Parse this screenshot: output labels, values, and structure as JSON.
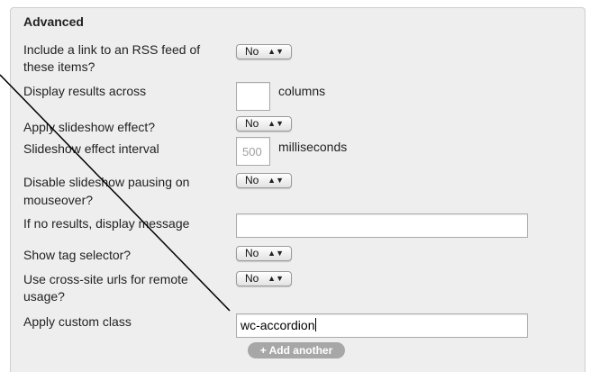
{
  "section": {
    "title": "Advanced"
  },
  "fields": {
    "rss_link": {
      "label_line1": "Include a link to an RSS feed of",
      "label_line2": "these items?",
      "value": "No"
    },
    "results_across": {
      "label": "Display results across",
      "value": "",
      "unit": "columns"
    },
    "slideshow": {
      "label": "Apply slideshow effect?",
      "value": "No"
    },
    "slideshow_interval": {
      "label": "Slideshow effect interval",
      "value": "500",
      "unit": "milliseconds"
    },
    "disable_pause": {
      "label_line1": "Disable slideshow pausing on",
      "label_line2": "mouseover?",
      "value": "No"
    },
    "no_results_message": {
      "label": "If no results, display message",
      "value": ""
    },
    "tag_selector": {
      "label": "Show tag selector?",
      "value": "No"
    },
    "cross_site_urls": {
      "label_line1": "Use cross-site urls for remote",
      "label_line2": "usage?",
      "value": "No"
    },
    "custom_class": {
      "label": "Apply custom class",
      "value": "wc-accordion"
    }
  },
  "buttons": {
    "add_another": "+ Add another"
  },
  "icons": {
    "select_arrows": "updown-arrows-icon"
  },
  "colors": {
    "panel_bg": "#eeeeee",
    "button_bg": "#a7a7a7"
  }
}
